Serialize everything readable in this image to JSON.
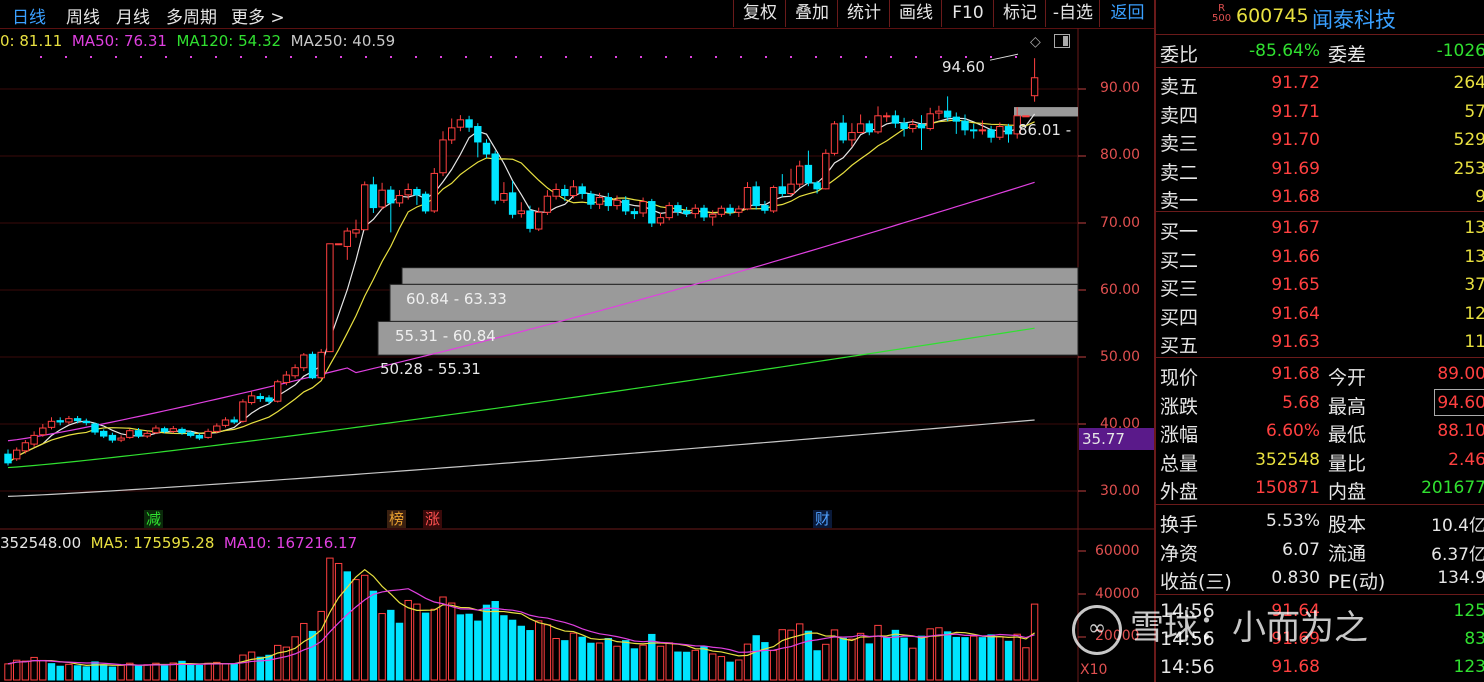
{
  "toolbar": {
    "left_tabs": [
      "日线",
      "周线",
      "月线",
      "多周期",
      "更多"
    ],
    "buttons": [
      "复权",
      "叠加",
      "统计",
      "画线",
      "F10",
      "标记",
      "-自选",
      "返回"
    ]
  },
  "ma_legend": [
    {
      "text": "0: 81.11",
      "color": "#e8e040"
    },
    {
      "text": "MA50: 76.31",
      "color": "#e040e0"
    },
    {
      "text": "MA120: 54.32",
      "color": "#30e030"
    },
    {
      "text": "MA250: 40.59",
      "color": "#c8c8c8"
    }
  ],
  "vol_legend": [
    {
      "text": "352548.00",
      "color": "#e6e6e6"
    },
    {
      "text": "MA5: 175595.28",
      "color": "#e8e040"
    },
    {
      "text": "MA10: 167216.17",
      "color": "#e040e0"
    }
  ],
  "price_axis": [
    "90.00",
    "80.00",
    "70.00",
    "60.00",
    "50.00",
    "40.00",
    "30.00"
  ],
  "current_price_tag": "35.77",
  "vol_axis": [
    "60000",
    "40000",
    "20000"
  ],
  "vol_unit": "X10",
  "annotations": {
    "high": "94.60",
    "close_level": "86.01 -",
    "gap1": "60.84 - 63.33",
    "gap2": "55.31 - 60.84",
    "gap3": "50.28 - 55.31"
  },
  "event_tags": [
    "减",
    "榜",
    "涨",
    "财"
  ],
  "stock": {
    "badge_top": "R",
    "badge_bottom": "500",
    "code": "600745",
    "name": "闻泰科技"
  },
  "order_ratio": {
    "label1": "委比",
    "value1": "-85.64%",
    "label2": "委差",
    "value2": "-1026"
  },
  "asks": [
    {
      "label": "卖五",
      "price": "91.72",
      "vol": "264"
    },
    {
      "label": "卖四",
      "price": "91.71",
      "vol": "57"
    },
    {
      "label": "卖三",
      "price": "91.70",
      "vol": "529"
    },
    {
      "label": "卖二",
      "price": "91.69",
      "vol": "253"
    },
    {
      "label": "卖一",
      "price": "91.68",
      "vol": "9"
    }
  ],
  "bids": [
    {
      "label": "买一",
      "price": "91.67",
      "vol": "13"
    },
    {
      "label": "买二",
      "price": "91.66",
      "vol": "13"
    },
    {
      "label": "买三",
      "price": "91.65",
      "vol": "37"
    },
    {
      "label": "买四",
      "price": "91.64",
      "vol": "12"
    },
    {
      "label": "买五",
      "price": "91.63",
      "vol": "11"
    }
  ],
  "quote": [
    {
      "l1": "现价",
      "v1": "91.68",
      "c1": "red",
      "l2": "今开",
      "v2": "89.00",
      "c2": "red"
    },
    {
      "l1": "涨跌",
      "v1": "5.68",
      "c1": "red",
      "l2": "最高",
      "v2": "94.60",
      "c2": "red"
    },
    {
      "l1": "涨幅",
      "v1": "6.60%",
      "c1": "red",
      "l2": "最低",
      "v2": "88.10",
      "c2": "red"
    },
    {
      "l1": "总量",
      "v1": "352548",
      "c1": "yellow",
      "l2": "量比",
      "v2": "2.46",
      "c2": "red"
    },
    {
      "l1": "外盘",
      "v1": "150871",
      "c1": "red",
      "l2": "内盘",
      "v2": "201677",
      "c2": "green"
    }
  ],
  "fundamentals": [
    {
      "l1": "换手",
      "v1": "5.53%",
      "l2": "股本",
      "v2": "10.4亿"
    },
    {
      "l1": "净资",
      "v1": "6.07",
      "l2": "流通",
      "v2": "6.37亿"
    },
    {
      "l1": "收益(三)",
      "v1": "0.830",
      "l2": "PE(动)",
      "v2": "134.9"
    }
  ],
  "ticks": [
    {
      "time": "14:56",
      "price": "91.64",
      "vol": "125"
    },
    {
      "time": "14:56",
      "price": "91.69",
      "vol": "83"
    },
    {
      "time": "14:56",
      "price": "91.68",
      "vol": "123"
    }
  ],
  "watermark": "雪球：小而为之",
  "colors": {
    "up": "#ff4040",
    "down": "#00e5ff",
    "ma5": "#e6e6e6",
    "ma10": "#e8e040",
    "ma50": "#e040e0",
    "ma120": "#30e030",
    "ma250": "#c8c8c8",
    "gap_fill": "#9a9a9a",
    "frame": "#6a1a1a"
  },
  "chart_data": {
    "type": "candlestick",
    "title": "",
    "ylim": [
      28,
      100
    ],
    "vol_ylim": [
      0,
      65000
    ],
    "candles": [
      [
        35.5,
        34.2,
        36.2,
        33.8
      ],
      [
        34.8,
        36.1,
        36.5,
        34.5
      ],
      [
        36.0,
        37.2,
        37.6,
        35.6
      ],
      [
        37.0,
        38.3,
        38.9,
        36.6
      ],
      [
        38.4,
        39.4,
        40.0,
        38.1
      ],
      [
        39.5,
        40.4,
        41.0,
        39.2
      ],
      [
        40.5,
        40.3,
        41.0,
        39.8
      ],
      [
        40.3,
        40.8,
        41.2,
        40.0
      ],
      [
        40.8,
        40.5,
        41.2,
        40.1
      ],
      [
        40.4,
        40.2,
        40.8,
        39.8
      ],
      [
        40.0,
        38.8,
        40.2,
        38.4
      ],
      [
        38.9,
        38.2,
        39.2,
        37.9
      ],
      [
        38.3,
        37.6,
        38.7,
        37.2
      ],
      [
        37.6,
        37.9,
        38.3,
        37.3
      ],
      [
        38.0,
        39.0,
        39.3,
        37.8
      ],
      [
        39.0,
        38.2,
        39.4,
        37.9
      ],
      [
        38.2,
        38.6,
        39.0,
        37.9
      ],
      [
        38.7,
        39.4,
        39.8,
        38.5
      ],
      [
        39.3,
        38.9,
        39.6,
        38.6
      ],
      [
        38.9,
        39.3,
        39.7,
        38.6
      ],
      [
        39.2,
        38.7,
        39.5,
        38.4
      ],
      [
        38.7,
        38.3,
        39.0,
        38.0
      ],
      [
        38.3,
        37.9,
        38.6,
        37.6
      ],
      [
        38.0,
        38.9,
        39.3,
        37.8
      ],
      [
        38.9,
        39.7,
        40.1,
        38.6
      ],
      [
        39.8,
        40.6,
        41.0,
        39.5
      ],
      [
        40.6,
        40.3,
        41.1,
        40.0
      ],
      [
        40.4,
        43.3,
        43.7,
        40.2
      ],
      [
        43.2,
        44.2,
        44.9,
        42.9
      ],
      [
        44.1,
        43.8,
        44.6,
        43.3
      ],
      [
        43.9,
        43.4,
        44.3,
        43.0
      ],
      [
        43.4,
        46.3,
        46.6,
        43.2
      ],
      [
        46.2,
        47.3,
        47.9,
        45.8
      ],
      [
        47.2,
        48.4,
        48.9,
        46.8
      ],
      [
        48.4,
        50.3,
        50.6,
        47.9
      ],
      [
        50.4,
        46.9,
        50.8,
        46.7
      ],
      [
        46.9,
        50.7,
        51.2,
        46.7
      ],
      [
        50.8,
        66.9,
        66.9,
        50.8
      ],
      [
        66.9,
        66.9,
        66.9,
        66.9
      ],
      [
        66.5,
        68.8,
        69.3,
        64.5
      ],
      [
        68.5,
        69.0,
        70.5,
        67.8
      ],
      [
        69.0,
        75.7,
        76.2,
        68.9
      ],
      [
        75.7,
        72.3,
        76.9,
        71.5
      ],
      [
        72.4,
        74.9,
        76.0,
        72.0
      ],
      [
        74.9,
        73.0,
        75.5,
        68.6
      ],
      [
        73.0,
        74.1,
        74.9,
        72.4
      ],
      [
        74.2,
        75.0,
        75.9,
        73.5
      ],
      [
        75.0,
        74.2,
        75.4,
        72.7
      ],
      [
        74.3,
        71.8,
        74.7,
        71.4
      ],
      [
        71.8,
        77.4,
        78.2,
        71.5
      ],
      [
        77.5,
        82.4,
        83.7,
        77.0
      ],
      [
        82.4,
        84.2,
        85.6,
        81.8
      ],
      [
        84.3,
        85.4,
        86.1,
        83.7
      ],
      [
        85.4,
        84.3,
        86.0,
        83.6
      ],
      [
        84.4,
        82.1,
        84.9,
        79.8
      ],
      [
        81.9,
        80.3,
        82.5,
        79.7
      ],
      [
        80.3,
        73.4,
        80.8,
        72.8
      ],
      [
        73.4,
        74.4,
        76.1,
        73.0
      ],
      [
        74.5,
        71.3,
        76.3,
        70.7
      ],
      [
        71.4,
        71.8,
        73.1,
        70.8
      ],
      [
        71.8,
        69.2,
        72.6,
        68.6
      ],
      [
        69.1,
        71.6,
        72.3,
        68.8
      ],
      [
        71.6,
        74.0,
        74.9,
        71.2
      ],
      [
        74.0,
        75.0,
        75.9,
        73.5
      ],
      [
        75.0,
        74.1,
        75.7,
        73.3
      ],
      [
        74.1,
        75.4,
        76.4,
        73.7
      ],
      [
        75.4,
        74.4,
        75.9,
        73.6
      ],
      [
        74.3,
        72.8,
        74.8,
        72.1
      ],
      [
        72.8,
        73.8,
        74.5,
        72.1
      ],
      [
        73.8,
        72.6,
        74.5,
        71.8
      ],
      [
        72.6,
        73.4,
        74.1,
        72.0
      ],
      [
        73.4,
        71.8,
        74.0,
        71.2
      ],
      [
        71.7,
        71.4,
        72.2,
        70.6
      ],
      [
        71.5,
        73.2,
        73.8,
        70.9
      ],
      [
        73.2,
        70.0,
        73.6,
        69.4
      ],
      [
        70.0,
        70.8,
        71.5,
        69.6
      ],
      [
        70.8,
        72.6,
        73.1,
        70.4
      ],
      [
        72.6,
        71.7,
        73.1,
        71.1
      ],
      [
        71.8,
        71.4,
        72.4,
        70.9
      ],
      [
        71.4,
        72.2,
        72.8,
        70.7
      ],
      [
        72.2,
        70.9,
        72.7,
        70.3
      ],
      [
        70.9,
        71.3,
        71.9,
        69.6
      ],
      [
        71.3,
        72.2,
        72.6,
        70.9
      ],
      [
        72.2,
        71.6,
        72.8,
        71.1
      ],
      [
        71.6,
        72.1,
        72.6,
        70.9
      ],
      [
        72.1,
        75.3,
        76.1,
        71.9
      ],
      [
        75.4,
        72.6,
        76.2,
        72.0
      ],
      [
        72.6,
        71.9,
        73.3,
        71.4
      ],
      [
        71.8,
        75.3,
        75.6,
        71.5
      ],
      [
        75.4,
        74.4,
        77.3,
        73.9
      ],
      [
        74.4,
        75.8,
        78.1,
        74.0
      ],
      [
        75.8,
        78.5,
        79.3,
        75.3
      ],
      [
        78.6,
        76.0,
        80.8,
        75.5
      ],
      [
        76.0,
        75.1,
        76.3,
        74.4
      ],
      [
        75.1,
        80.4,
        81.0,
        75.0
      ],
      [
        80.4,
        84.8,
        85.2,
        80.1
      ],
      [
        84.9,
        82.4,
        86.1,
        81.9
      ],
      [
        82.4,
        83.5,
        84.9,
        81.4
      ],
      [
        83.5,
        84.8,
        86.2,
        83.4
      ],
      [
        84.8,
        83.6,
        85.3,
        83.1
      ],
      [
        83.6,
        86.0,
        87.4,
        83.3
      ],
      [
        86.0,
        86.0,
        86.5,
        85.1
      ],
      [
        86.0,
        84.9,
        86.8,
        84.2
      ],
      [
        84.9,
        84.1,
        85.7,
        82.9
      ],
      [
        84.1,
        84.7,
        85.5,
        83.5
      ],
      [
        84.7,
        84.2,
        86.1,
        80.9
      ],
      [
        84.1,
        86.3,
        87.2,
        83.8
      ],
      [
        86.4,
        86.7,
        87.5,
        85.5
      ],
      [
        86.7,
        85.8,
        88.9,
        85.2
      ],
      [
        85.8,
        85.2,
        86.5,
        83.3
      ],
      [
        85.2,
        83.9,
        86.2,
        83.1
      ],
      [
        83.9,
        83.8,
        84.8,
        82.6
      ],
      [
        83.8,
        83.9,
        85.3,
        83.2
      ],
      [
        83.9,
        82.8,
        84.5,
        82.0
      ],
      [
        82.8,
        84.4,
        85.0,
        82.4
      ],
      [
        84.4,
        83.3,
        84.8,
        82.0
      ],
      [
        83.3,
        86.0,
        87.3,
        82.6
      ],
      [
        86.0,
        86.0,
        86.0,
        86.0
      ],
      [
        89.0,
        91.68,
        94.6,
        88.1
      ]
    ],
    "volume": [
      [
        7500,
        1
      ],
      [
        9200,
        1
      ],
      [
        8800,
        1
      ],
      [
        10500,
        1
      ],
      [
        9100,
        1
      ],
      [
        7600,
        0
      ],
      [
        6400,
        0
      ],
      [
        7300,
        1
      ],
      [
        6600,
        0
      ],
      [
        6100,
        0
      ],
      [
        8400,
        0
      ],
      [
        7100,
        0
      ],
      [
        6000,
        0
      ],
      [
        6800,
        1
      ],
      [
        7800,
        1
      ],
      [
        6700,
        0
      ],
      [
        7100,
        1
      ],
      [
        7800,
        1
      ],
      [
        6600,
        0
      ],
      [
        7900,
        1
      ],
      [
        8700,
        0
      ],
      [
        7200,
        0
      ],
      [
        6800,
        0
      ],
      [
        7800,
        1
      ],
      [
        8200,
        1
      ],
      [
        7600,
        1
      ],
      [
        7500,
        0
      ],
      [
        11600,
        1
      ],
      [
        13000,
        1
      ],
      [
        10600,
        0
      ],
      [
        11500,
        0
      ],
      [
        16100,
        1
      ],
      [
        15300,
        1
      ],
      [
        20100,
        1
      ],
      [
        26300,
        1
      ],
      [
        22600,
        0
      ],
      [
        31900,
        1
      ],
      [
        56700,
        1
      ],
      [
        54200,
        1
      ],
      [
        50300,
        0
      ],
      [
        46700,
        1
      ],
      [
        48700,
        1
      ],
      [
        41300,
        0
      ],
      [
        30900,
        1
      ],
      [
        32400,
        0
      ],
      [
        26400,
        0
      ],
      [
        37000,
        1
      ],
      [
        35300,
        1
      ],
      [
        31100,
        0
      ],
      [
        32900,
        1
      ],
      [
        38600,
        1
      ],
      [
        35800,
        1
      ],
      [
        30300,
        0
      ],
      [
        30600,
        0
      ],
      [
        27400,
        0
      ],
      [
        34800,
        0
      ],
      [
        36500,
        0
      ],
      [
        29900,
        0
      ],
      [
        27800,
        0
      ],
      [
        25000,
        0
      ],
      [
        23000,
        0
      ],
      [
        27500,
        1
      ],
      [
        25700,
        1
      ],
      [
        19300,
        1
      ],
      [
        18300,
        0
      ],
      [
        21800,
        1
      ],
      [
        19900,
        0
      ],
      [
        17100,
        0
      ],
      [
        17200,
        1
      ],
      [
        19300,
        0
      ],
      [
        15700,
        1
      ],
      [
        18300,
        0
      ],
      [
        14500,
        0
      ],
      [
        16200,
        1
      ],
      [
        21200,
        0
      ],
      [
        15700,
        1
      ],
      [
        17300,
        1
      ],
      [
        13000,
        0
      ],
      [
        12900,
        0
      ],
      [
        13800,
        1
      ],
      [
        15500,
        0
      ],
      [
        12100,
        1
      ],
      [
        10900,
        1
      ],
      [
        8300,
        0
      ],
      [
        9300,
        1
      ],
      [
        16700,
        1
      ],
      [
        20600,
        0
      ],
      [
        17400,
        0
      ],
      [
        13700,
        1
      ],
      [
        23400,
        1
      ],
      [
        23200,
        1
      ],
      [
        26100,
        1
      ],
      [
        22700,
        0
      ],
      [
        13600,
        0
      ],
      [
        16600,
        1
      ],
      [
        23300,
        1
      ],
      [
        19400,
        0
      ],
      [
        19000,
        1
      ],
      [
        21700,
        1
      ],
      [
        16800,
        0
      ],
      [
        25400,
        1
      ],
      [
        19800,
        0
      ],
      [
        23100,
        0
      ],
      [
        19500,
        0
      ],
      [
        14800,
        1
      ],
      [
        20400,
        0
      ],
      [
        23800,
        1
      ],
      [
        24300,
        1
      ],
      [
        22400,
        0
      ],
      [
        19800,
        0
      ],
      [
        19700,
        0
      ],
      [
        20400,
        1
      ],
      [
        19700,
        0
      ],
      [
        21000,
        0
      ],
      [
        20100,
        1
      ],
      [
        18000,
        0
      ],
      [
        21300,
        1
      ],
      [
        15000,
        1
      ],
      [
        35300,
        1
      ]
    ]
  }
}
